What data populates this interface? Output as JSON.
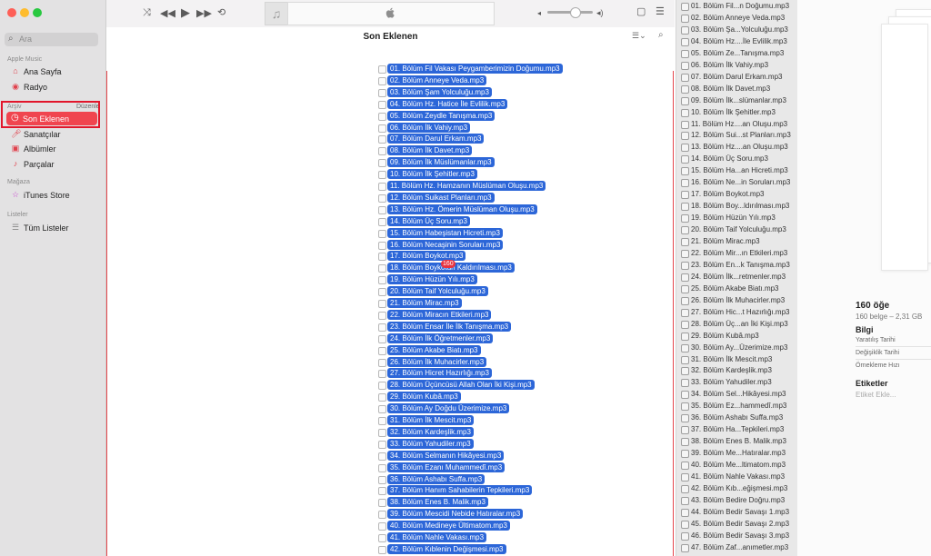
{
  "sidebar": {
    "search_placeholder": "Ara",
    "sections": {
      "apple_music": "Apple Music",
      "library": "Arşiv",
      "store": "Mağaza",
      "playlists": "Listeler"
    },
    "edit_label": "Düzenle",
    "items": {
      "home": "Ana Sayfa",
      "radio": "Radyo",
      "recently_added": "Son Eklenen",
      "artists": "Sanatçılar",
      "albums": "Albümler",
      "songs": "Parçalar",
      "itunes_store": "iTunes Store",
      "all_playlists": "Tüm Listeler"
    }
  },
  "main": {
    "title": "Son Eklenen",
    "drag_badge": "160",
    "drag_items": [
      "01. Bölüm Fil Vakası Peygamberimizin Doğumu.mp3",
      "02. Bölüm Anneye Veda.mp3",
      "03. Bölüm Şam Yolculuğu.mp3",
      "04. Bölüm Hz. Hatice İle Evlilik.mp3",
      "05. Bölüm Zeydle Tanışma.mp3",
      "06. Bölüm İlk Vahiy.mp3",
      "07. Bölüm Darul Erkam.mp3",
      "08. Bölüm İlk Davet.mp3",
      "09. Bölüm İlk Müslümanlar.mp3",
      "10. Bölüm İlk Şehitler.mp3",
      "11. Bölüm Hz. Hamzanın Müslüman Oluşu.mp3",
      "12. Bölüm Suikast Planları.mp3",
      "13. Bölüm Hz. Ömerin Müslüman Oluşu.mp3",
      "14. Bölüm Üç Soru.mp3",
      "15. Bölüm Habeşistan Hicreti.mp3",
      "16. Bölüm Necaşinin Soruları.mp3",
      "17. Bölüm Boykot.mp3",
      "18. Bölüm Boykotun Kaldırılması.mp3",
      "19. Bölüm Hüzün Yılı.mp3",
      "20. Bölüm Taif Yolculuğu.mp3",
      "21. Bölüm Mirac.mp3",
      "22. Bölüm Miracın Etkileri.mp3",
      "23. Bölüm Ensar İle İlk Tanışma.mp3",
      "24. Bölüm İlk Öğretmenler.mp3",
      "25. Bölüm Akabe Biatı.mp3",
      "26. Bölüm İlk Muhacirler.mp3",
      "27. Bölüm Hicret Hazırlığı.mp3",
      "28. Bölüm Üçüncüsü Allah Olan İki Kişi.mp3",
      "29. Bölüm Kubâ.mp3",
      "30. Bölüm Ay Doğdu Üzerimize.mp3",
      "31. Bölüm İlk Mescit.mp3",
      "32. Bölüm Kardeşlik.mp3",
      "33. Bölüm Yahudiler.mp3",
      "34. Bölüm Selmanın Hikâyesi.mp3",
      "35. Bölüm Ezanı Muhammedî.mp3",
      "36. Bölüm Ashabı Suffa.mp3",
      "37. Bölüm Hanım Sahabilerin Tepkileri.mp3",
      "38. Bölüm Enes B. Malik.mp3",
      "39. Bölüm Mescidi Nebide Hatıralar.mp3",
      "40. Bölüm Medineye Ültimatom.mp3",
      "41. Bölüm Nahle Vakası.mp3",
      "42. Bölüm Kıblenin Değişmesi.mp3"
    ]
  },
  "file_list": [
    "01. Bölüm Fil...n Doğumu.mp3",
    "02. Bölüm Anneye Veda.mp3",
    "03. Bölüm Şa...Yolculuğu.mp3",
    "04. Bölüm Hz....İle Evlilik.mp3",
    "05. Bölüm Ze...Tanışma.mp3",
    "06. Bölüm İlk Vahiy.mp3",
    "07. Bölüm Darul Erkam.mp3",
    "08. Bölüm İlk Davet.mp3",
    "09. Bölüm İlk...slümanlar.mp3",
    "10. Bölüm İlk Şehitler.mp3",
    "11. Bölüm Hz....an Oluşu.mp3",
    "12. Bölüm Sui...st Planları.mp3",
    "13. Bölüm Hz....an Oluşu.mp3",
    "14. Bölüm Üç Soru.mp3",
    "15. Bölüm Ha...an Hicreti.mp3",
    "16. Bölüm Ne...in Soruları.mp3",
    "17. Bölüm Boykot.mp3",
    "18. Bölüm Boy...ldırılması.mp3",
    "19. Bölüm Hüzün Yılı.mp3",
    "20. Bölüm Taif Yolculuğu.mp3",
    "21. Bölüm Mirac.mp3",
    "22. Bölüm Mir...ın Etkileri.mp3",
    "23. Bölüm En...k Tanışma.mp3",
    "24. Bölüm İlk...retmenler.mp3",
    "25. Bölüm Akabe Biatı.mp3",
    "26. Bölüm İlk Muhacirler.mp3",
    "27. Bölüm Hic...t Hazırlığı.mp3",
    "28. Bölüm Üç...an İki Kişi.mp3",
    "29. Bölüm Kubâ.mp3",
    "30. Bölüm Ay...Üzerimize.mp3",
    "31. Bölüm İlk Mescit.mp3",
    "32. Bölüm Kardeşlik.mp3",
    "33. Bölüm Yahudiler.mp3",
    "34. Bölüm Sel...Hikâyesi.mp3",
    "35. Bölüm Ez...hammedî.mp3",
    "36. Bölüm Ashabı Suffa.mp3",
    "37. Bölüm Ha...Tepkileri.mp3",
    "38. Bölüm Enes B. Malik.mp3",
    "39. Bölüm Me...Hatıralar.mp3",
    "40. Bölüm Me...ltimatom.mp3",
    "41. Bölüm Nahle Vakası.mp3",
    "42. Bölüm Kıb...eğişmesi.mp3",
    "43. Bölüm Bedire Doğru.mp3",
    "44. Bölüm Bedir Savaşı 1.mp3",
    "45. Bölüm Bedir Savaşı 2.mp3",
    "46. Bölüm Bedir Savaşı 3.mp3",
    "47. Bölüm Zaf...anımetler.mp3"
  ],
  "info": {
    "count": "160 öğe",
    "size": "160 belge – 2,31 GB",
    "section_info": "Bilgi",
    "created": "Yaratılış Tarihi",
    "modified": "Değişiklik Tarihi",
    "sample_rate": "Örnekleme Hızı",
    "section_tags": "Etiketler",
    "add_tags": "Etiket Ekle..."
  },
  "colors": {
    "accent": "#f0454f",
    "selection": "#2c66d8",
    "highlight_outline": "#e2162b"
  }
}
